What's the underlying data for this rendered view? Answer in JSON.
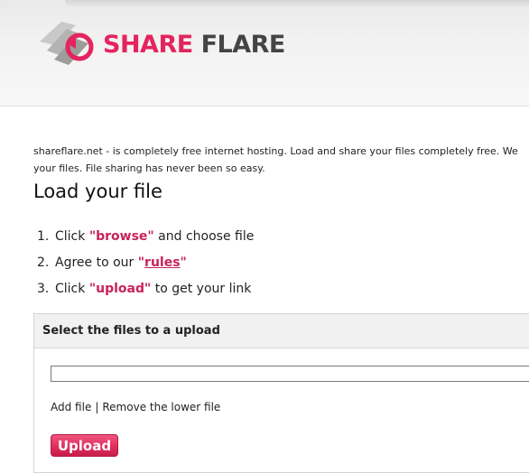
{
  "brand": {
    "name_part1": "SHARE",
    "name_part2": "FLARE",
    "accent_color": "#e4245f",
    "icon": "shareflare-logo-icon"
  },
  "intro": {
    "line1": "shareflare.net - is completely free internet hosting. Load and share your files completely free. We",
    "line2": "your files. File sharing has never been so easy."
  },
  "page_title": "Load your file",
  "steps": [
    {
      "num": "1.",
      "pre": "Click ",
      "highlight": "\"browse\"",
      "post": " and choose file"
    },
    {
      "num": "2.",
      "pre": "Agree to our ",
      "quote_open": "\"",
      "link": "rules",
      "quote_close": "\"",
      "post": ""
    },
    {
      "num": "3.",
      "pre": "Click ",
      "highlight": "\"upload\"",
      "post": " to get your link"
    }
  ],
  "upload_panel": {
    "title": "Select the files to a upload",
    "file_input_value": "",
    "add_file_label": "Add file",
    "separator": "|",
    "remove_file_label": "Remove the lower file",
    "upload_button_label": "Upload"
  }
}
